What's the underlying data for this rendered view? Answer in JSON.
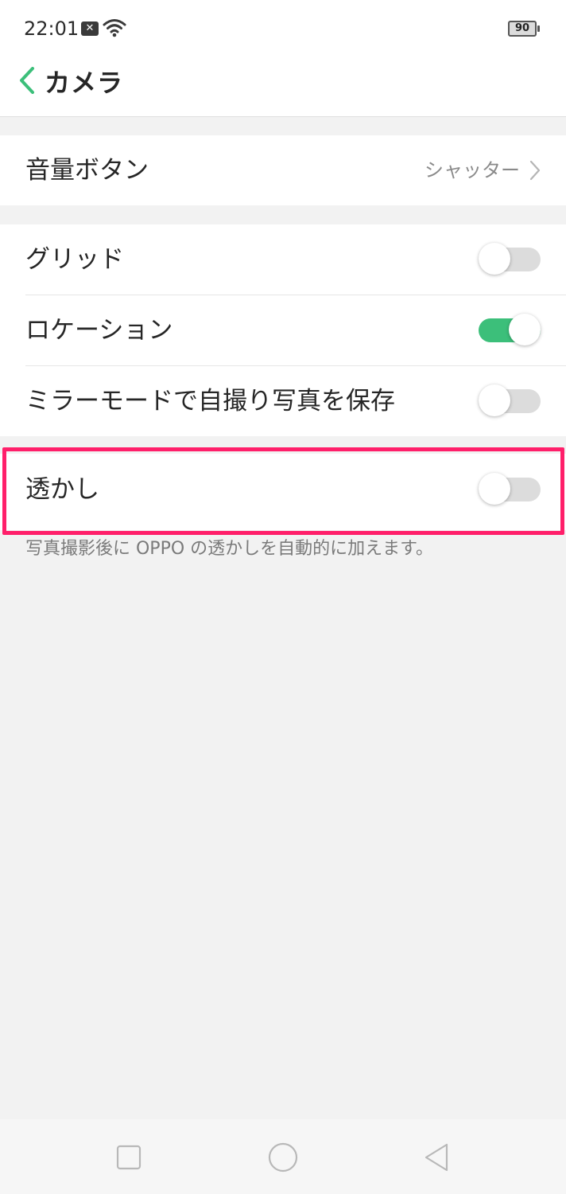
{
  "status_bar": {
    "time": "22:01",
    "notification_badge": "✕",
    "battery": "90"
  },
  "header": {
    "title": "カメラ"
  },
  "settings": {
    "volume_button": {
      "label": "音量ボタン",
      "value": "シャッター"
    },
    "grid": {
      "label": "グリッド",
      "enabled": false
    },
    "location": {
      "label": "ロケーション",
      "enabled": true
    },
    "mirror_mode": {
      "label": "ミラーモードで自撮り写真を保存",
      "enabled": false
    },
    "watermark": {
      "label": "透かし",
      "enabled": false,
      "description": "写真撮影後に OPPO の透かしを自動的に加えます。"
    }
  },
  "colors": {
    "accent": "#3cbf7a",
    "highlight": "#ff1f6a"
  },
  "icons": {
    "back": "chevron-left-icon",
    "chevron": "chevron-right-icon",
    "wifi": "wifi-icon",
    "nav_recent": "square-icon",
    "nav_home": "circle-icon",
    "nav_back": "triangle-back-icon"
  }
}
